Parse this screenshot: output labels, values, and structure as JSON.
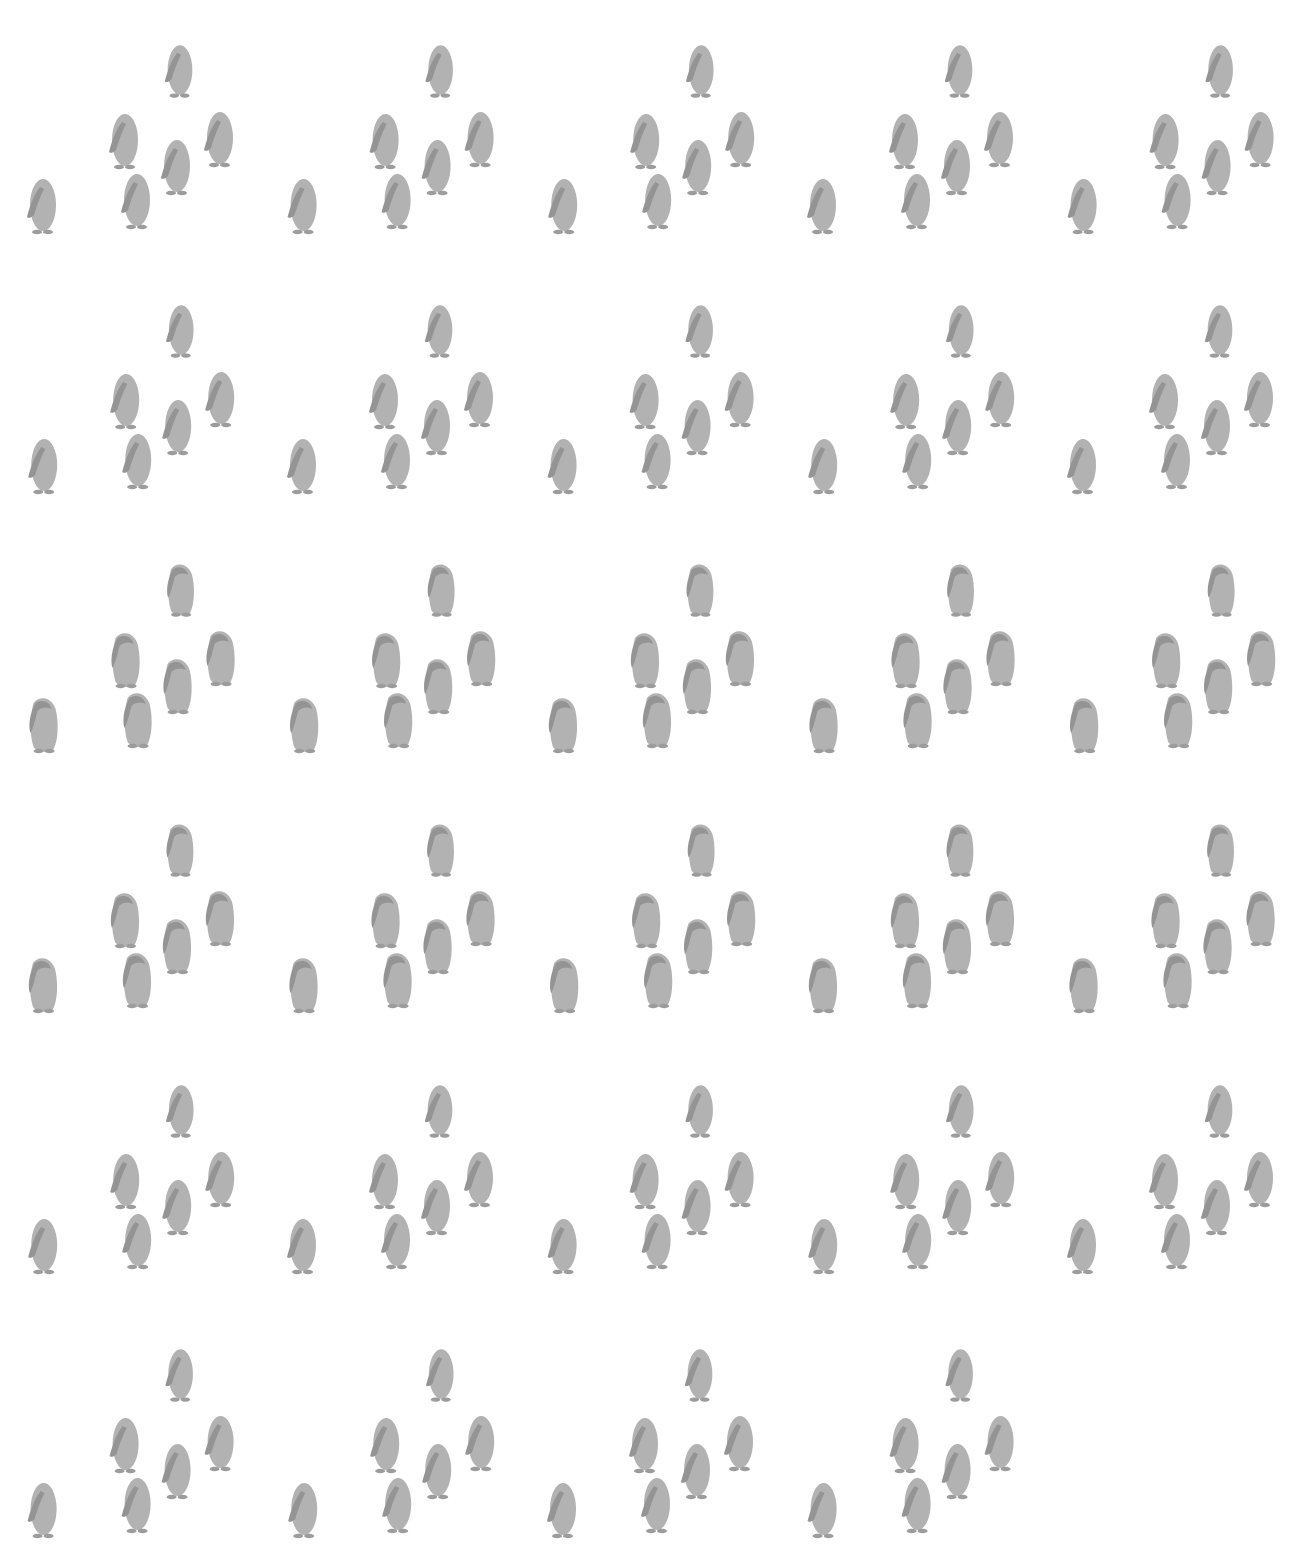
{
  "sprite_sheet": {
    "frame_count": 29,
    "columns": 5,
    "rows": 6,
    "frames_per_row": [
      5,
      5,
      5,
      5,
      5,
      4
    ],
    "figures_per_frame": 6,
    "figure_icon": "penguin-icon",
    "colors": {
      "background": "#ffffff",
      "body": "#b2b2b2",
      "wing": "#949494",
      "feet": "#9c9c9c"
    }
  }
}
